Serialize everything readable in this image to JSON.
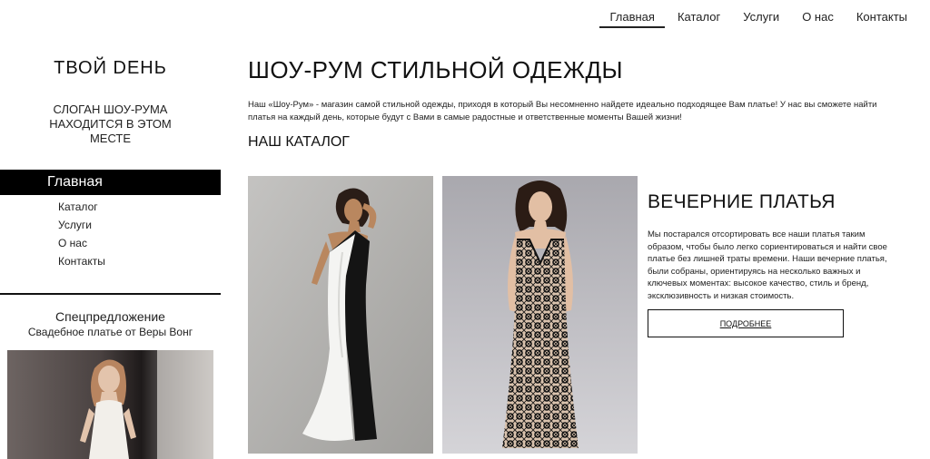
{
  "topnav": [
    "Главная",
    "Каталог",
    "Услуги",
    "О нас",
    "Контакты"
  ],
  "sidebar": {
    "brand": "ТВОЙ DEHЬ",
    "slogan": "СЛОГАН ШОУ-РУМА НАХОДИТСЯ В ЭТОМ МЕСТЕ",
    "active_item": "Главная",
    "items": [
      "Каталог",
      "Услуги",
      "О нас",
      "Контакты"
    ],
    "promo_title": "Спецпредложение",
    "promo_subtitle": "Свадебное платье от Веры Вонг"
  },
  "main": {
    "title": "ШОУ-РУМ СТИЛЬНОЙ ОДЕЖДЫ",
    "intro": "Наш «Шоу-Рум» - магазин самой стильной одежды, приходя в который Вы несомненно найдете идеально подходящее Вам платье! У нас вы сможете найти платья на каждый день, которые будут с Вами в самые радостные и ответственные моменты Вашей жизни!",
    "catalog_title": "НАШ КАТАЛОГ",
    "section_title": "ВЕЧЕРНИЕ ПЛАТЬЯ",
    "section_text": "Мы постарался отсортировать все наши платья таким образом, чтобы было легко сориентироваться и найти свое платье без лишней траты времени. Наши вечерние платья, были собраны, ориентируясь на несколько важных и ключевых моментах: высокое качество, стиль и бренд, эксклюзивность и низкая стоимость.",
    "more_button": "ПОДРОБНЕЕ"
  }
}
